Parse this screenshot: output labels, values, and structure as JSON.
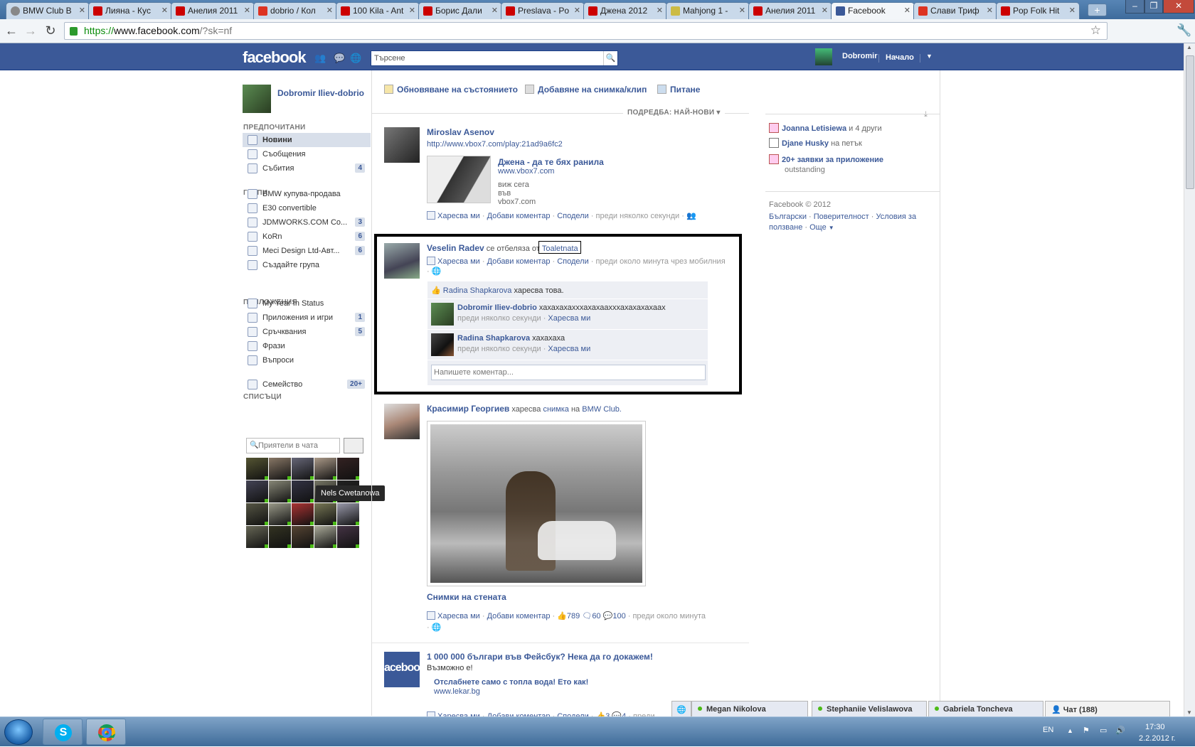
{
  "browser": {
    "tabs": [
      {
        "title": "BMW Club B",
        "fav": "bm"
      },
      {
        "title": "Лияна - Куc",
        "fav": "yt"
      },
      {
        "title": "Анелия 2011",
        "fav": "yt"
      },
      {
        "title": "dobrio / Кол",
        "fav": "b7"
      },
      {
        "title": "100 Kila - Ant",
        "fav": "yt"
      },
      {
        "title": "Борис Дали",
        "fav": "yt"
      },
      {
        "title": "Preslava - Po",
        "fav": "yt"
      },
      {
        "title": "Джена 2012",
        "fav": "yt"
      },
      {
        "title": "Mahjong 1 -",
        "fav": "mj"
      },
      {
        "title": "Анелия 2011",
        "fav": "yt"
      },
      {
        "title": "Facebook",
        "fav": "fb",
        "active": true
      },
      {
        "title": "Слави Триф",
        "fav": "b7"
      },
      {
        "title": "Pop Folk Hit",
        "fav": "yt"
      }
    ],
    "url_scheme": "https://",
    "url_host": "www.facebook.com",
    "url_path": "/?sk=nf"
  },
  "header": {
    "logo": "facebook",
    "search_placeholder": "Търсене",
    "user_name": "Dobromir",
    "home": "Начало"
  },
  "left": {
    "profile_name": "Dobromir Iliev-dobrio",
    "favorites_heading": "ПРЕДПОЧИТАНИ",
    "favorites": [
      {
        "label": "Новини",
        "selected": true,
        "count": ""
      },
      {
        "label": "Съобщения",
        "count": ""
      },
      {
        "label": "Събития",
        "count": "4"
      }
    ],
    "groups_heading": "ГРУПИ",
    "groups": [
      {
        "label": "BMW купува-продава",
        "count": ""
      },
      {
        "label": "E30 convertible",
        "count": ""
      },
      {
        "label": "JDMWORKS.COM Co...",
        "count": "3"
      },
      {
        "label": "KoRn",
        "count": "6"
      },
      {
        "label": "Meci Design Ltd-Авт...",
        "count": "6"
      },
      {
        "label": "Създайте група",
        "count": ""
      }
    ],
    "apps_heading": "ПРИЛОЖЕНИЯ",
    "apps": [
      {
        "label": "My Year In Status",
        "count": ""
      },
      {
        "label": "Приложения и игри",
        "count": "1"
      },
      {
        "label": "Сръчквания",
        "count": "5"
      },
      {
        "label": "Фрази",
        "count": ""
      },
      {
        "label": "Въпроси",
        "count": ""
      }
    ],
    "lists_heading": "СПИСЪЦИ",
    "lists": [
      {
        "label": "Семейство",
        "count": "20+"
      }
    ],
    "chat_search_placeholder": "Приятели в чата",
    "tooltip": "Nels Cwetanowa"
  },
  "composer": {
    "status": "Обновяване на състоянието",
    "photo": "Добавяне на снимка/клип",
    "question": "Питане"
  },
  "sort_label": "ПОДРЕДБА: НАЙ-НОВИ",
  "stories": {
    "s1": {
      "actor": "Miroslav Asenov",
      "link": "http://www.vbox7.com/play:21ad9a6fc2",
      "prev_title": "Джена - да те бях ранила",
      "prev_domain": "www.vbox7.com",
      "prev_desc": "виж сега във vbox7.com",
      "like": "Харесва ми",
      "comment": "Добави коментар",
      "share": "Сподели",
      "time": "преди няколко секунди"
    },
    "s2": {
      "actor": "Veselin Radev",
      "verb": "се отбеляза от",
      "place": "Toaletnata",
      "like": "Харесва ми",
      "comment": "Добави коментар",
      "share": "Сподели",
      "time": "преди около минута чрез мобилния",
      "likes_name": "Radina Shapkarova",
      "likes_text": "харесва това.",
      "c1_name": "Dobromir Iliev-dobrio",
      "c1_text": "хахахахахххахахаахххахахахахаах",
      "c1_time": "преди няколко секунди",
      "c2_name": "Radina Shapkarova",
      "c2_text": "хахахаха",
      "c2_time": "преди няколко секунди",
      "c_like": "Харесва ми",
      "write_placeholder": "Напишете коментар..."
    },
    "s3": {
      "actor": "Красимир Георгиев",
      "verb": "харесва",
      "obj": "снимка",
      "on": "на",
      "page": "BMW Club.",
      "album": "Снимки на стената",
      "like": "Харесва ми",
      "comment": "Добави коментар",
      "likes_count": "789",
      "shares_count": "60",
      "comments_count": "100",
      "time": "преди около минута"
    },
    "s4": {
      "actor": "1 000 000 българи във Фейсбук? Нека да го докажем!",
      "text": "Възможно е!",
      "prev_title": "Отслабнете само с топла вода! Ето как!",
      "prev_domain": "www.lekar.bg",
      "like": "Харесва ми",
      "comment": "Добави коментар",
      "share": "Сподели",
      "likes_count": "3",
      "comments_count": "4",
      "time": "преди"
    }
  },
  "right": {
    "r1_name": "Joanna Letisiewa",
    "r1_rest": "и 4 други",
    "r2_name": "Djane Husky",
    "r2_rest": "на петък",
    "r3_name": "20+ заявки за приложение",
    "r3_sub": "outstanding",
    "copyright": "Facebook © 2012",
    "lang": "Български",
    "privacy": "Поверителност",
    "terms": "Условия за ползване",
    "more": "Още"
  },
  "chat_dock": {
    "c1": "Megan Nikolova",
    "c2": "Stephaniie Velislawova",
    "c3": "Gabriela Toncheva",
    "chat": "Чат (188)"
  },
  "taskbar": {
    "lang": "EN",
    "time": "17:30",
    "date": "2.2.2012 г."
  },
  "colors": {
    "fb_blue": "#3b5998",
    "link": "#3b5998",
    "online": "#4cbb17"
  }
}
